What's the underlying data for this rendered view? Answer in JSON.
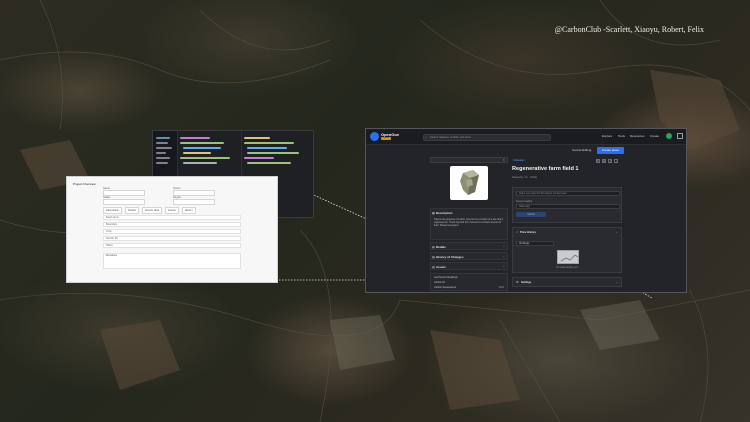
{
  "credit": "@CarbonClub -Scarlett, Xiaoyu, Robert, Felix",
  "app": {
    "brand": "OpenGov",
    "brand_badge": "BETA",
    "search_placeholder": "Search datasets, models, and more",
    "nav": [
      "Explore",
      "Tools",
      "Resources",
      "Create"
    ],
    "cancel_label": "Cancel Editing",
    "create_label": "Create place",
    "breadcrumb": "< Datasets",
    "title": "Regenerative farm field 1",
    "meta": "Owned by: J.C.  ·  Public",
    "left": {
      "description_title": "Description",
      "description_text": "Tokens the purpose of a farm. Amount is a number of a site that it registered on. Track log field from harvest to contract amount of field. Shared as project",
      "sections": [
        "Details",
        "History of Changes",
        "Assets"
      ],
      "rows": [
        {
          "k": "Last Sensor Readings",
          "v": ""
        },
        {
          "k": "Carbon ID",
          "v": ""
        },
        {
          "k": "Carbon Sequestered",
          "v": "2022"
        }
      ]
    },
    "right": {
      "prompt": "Add a new value for this field or contact team",
      "sensor_label": "Sensor reading",
      "value_placeholder": "Value (kg)",
      "submit": "Submit",
      "price_title": "Price History",
      "range": "All Range",
      "empty_text": "No trade activity yet",
      "settings_title": "Settings"
    }
  },
  "admin": {
    "title": "Project Overview",
    "fields": [
      "Name",
      "Owner",
      "Status",
      "Region",
      "Type",
      "Area"
    ],
    "tabs": [
      "Description",
      "Details",
      "Sensor data",
      "Assets",
      "History"
    ],
    "rows": [
      "Field name",
      "Boundary",
      "Crop",
      "Sensor ID",
      "Notes",
      "Metadata"
    ]
  }
}
